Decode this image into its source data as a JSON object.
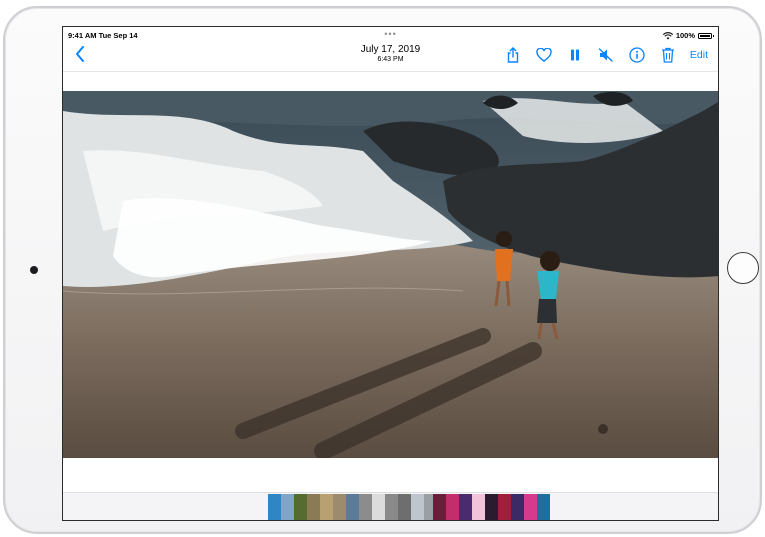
{
  "status": {
    "time": "9:41 AM  Tue Sep 14",
    "battery": "100%",
    "battery_level": 1.0
  },
  "nav": {
    "title": "July 17, 2019",
    "subtitle": "6:43 PM",
    "edit_label": "Edit"
  },
  "icons": [
    "back-chevron-icon",
    "share-icon",
    "heart-icon",
    "pause-icon",
    "mute-icon",
    "info-icon",
    "trash-icon"
  ],
  "colors": {
    "accent": "#0a84ff"
  },
  "filmstrip": {
    "groups": [
      [
        "#2f86c4",
        "#7fa6c9",
        "#556b2f",
        "#8a7a55",
        "#b9a070",
        "#9c8b6c",
        "#5c7a9a"
      ],
      [
        "#8c8c8c",
        "#dcdcdc",
        "#8a8a8a",
        "#6e6e6e",
        "#bfc5cc",
        "#9a9fa6",
        "#4d5158"
      ],
      [
        "#6b1d3a",
        "#c22d6b",
        "#4a2c6e",
        "#f2c4d9",
        "#2a1c2e",
        "#a01f3d",
        "#3b2a66",
        "#d63a8b",
        "#1f6f9c"
      ]
    ]
  }
}
